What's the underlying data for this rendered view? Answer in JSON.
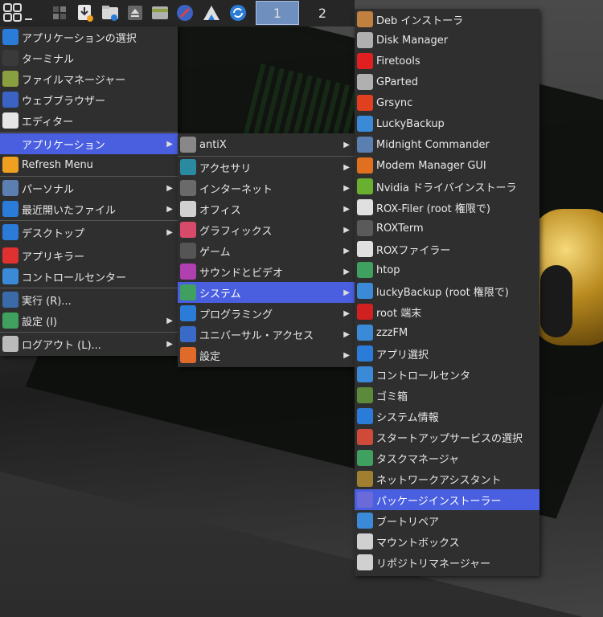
{
  "taskbar": {
    "workspaces": [
      "1",
      "2"
    ],
    "active_workspace": "1"
  },
  "main_menu": {
    "items": [
      {
        "label": "アプリケーションの選択",
        "icon": "search-icon",
        "color": "#2b7bd8"
      },
      {
        "label": "ターミナル",
        "icon": "terminal-icon",
        "color": "#3a3a3a"
      },
      {
        "label": "ファイルマネージャー",
        "icon": "file-manager-icon",
        "color": "#8aa040"
      },
      {
        "label": "ウェブブラウザー",
        "icon": "browser-icon",
        "color": "#3b63c4"
      },
      {
        "label": "エディター",
        "icon": "editor-icon",
        "color": "#e6e6e6"
      },
      {
        "label": "アプリケーション",
        "icon": "apps-grid-icon",
        "color": "#4a5fe0"
      },
      {
        "label": "Refresh Menu",
        "icon": "refresh-icon",
        "color": "#f0a020"
      },
      {
        "label": "パーソナル",
        "icon": "user-icon",
        "color": "#5a7fb0"
      },
      {
        "label": "最近開いたファイル",
        "icon": "recent-icon",
        "color": "#2b7bd8"
      },
      {
        "label": "デスクトップ",
        "icon": "desktop-icon",
        "color": "#2b7bd8"
      },
      {
        "label": "アプリキラー",
        "icon": "kill-icon",
        "color": "#e03030"
      },
      {
        "label": "コントロールセンター",
        "icon": "control-center-icon",
        "color": "#3a8ad8"
      },
      {
        "label": "実行 (R)...",
        "icon": "run-icon",
        "color": "#3a6aa8"
      },
      {
        "label": "設定 (I)",
        "icon": "settings-icon",
        "color": "#40a060"
      },
      {
        "label": "ログアウト (L)...",
        "icon": "power-icon",
        "color": "#bbbbbb"
      }
    ]
  },
  "apps_menu": {
    "items": [
      {
        "label": "antiX",
        "icon": "antix-icon",
        "color": "#888888"
      },
      {
        "label": "アクセサリ",
        "icon": "accessories-icon",
        "color": "#2a8aa0"
      },
      {
        "label": "インターネット",
        "icon": "internet-icon",
        "color": "#6a6a6a"
      },
      {
        "label": "オフィス",
        "icon": "office-icon",
        "color": "#d0d0d0"
      },
      {
        "label": "グラフィックス",
        "icon": "graphics-icon",
        "color": "#d84a6a"
      },
      {
        "label": "ゲーム",
        "icon": "game-icon",
        "color": "#555555"
      },
      {
        "label": "サウンドとビデオ",
        "icon": "multimedia-icon",
        "color": "#b040b0"
      },
      {
        "label": "システム",
        "icon": "system-icon",
        "color": "#40a060"
      },
      {
        "label": "プログラミング",
        "icon": "programming-icon",
        "color": "#2b7bd8"
      },
      {
        "label": "ユニバーサル・アクセス",
        "icon": "accessibility-icon",
        "color": "#3a6ac8"
      },
      {
        "label": "設定",
        "icon": "settings-icon",
        "color": "#e06a2a"
      }
    ]
  },
  "system_menu": {
    "items": [
      {
        "label": "Deb インストーラ",
        "icon": "deb-installer-icon",
        "color": "#c08040"
      },
      {
        "label": "Disk Manager",
        "icon": "disk-manager-icon",
        "color": "#b0b0b0"
      },
      {
        "label": "Firetools",
        "icon": "firetools-icon",
        "color": "#e02020"
      },
      {
        "label": "GParted",
        "icon": "gparted-icon",
        "color": "#b0b0b0"
      },
      {
        "label": "Grsync",
        "icon": "grsync-icon",
        "color": "#e04020"
      },
      {
        "label": "LuckyBackup",
        "icon": "luckybackup-icon",
        "color": "#3a8ad8"
      },
      {
        "label": "Midnight Commander",
        "icon": "midnight-commander-icon",
        "color": "#5a7fb0"
      },
      {
        "label": "Modem Manager GUI",
        "icon": "modem-icon",
        "color": "#e07020"
      },
      {
        "label": "Nvidia ドライバインストーラ",
        "icon": "nvidia-icon",
        "color": "#6ab030"
      },
      {
        "label": "ROX-Filer (root 権限で)",
        "icon": "rox-filer-icon",
        "color": "#e0e0e0"
      },
      {
        "label": "ROXTerm",
        "icon": "roxterm-icon",
        "color": "#5a5a5a"
      },
      {
        "label": "ROXファイラー",
        "icon": "rox-filer-icon",
        "color": "#e0e0e0"
      },
      {
        "label": "htop",
        "icon": "htop-icon",
        "color": "#40a060"
      },
      {
        "label": "luckyBackup (root 権限で)",
        "icon": "luckybackup-icon",
        "color": "#3a8ad8"
      },
      {
        "label": "root 端末",
        "icon": "root-terminal-icon",
        "color": "#d02020"
      },
      {
        "label": "zzzFM",
        "icon": "zzzfm-icon",
        "color": "#3a8ad8"
      },
      {
        "label": "アプリ選択",
        "icon": "search-icon",
        "color": "#2b7bd8"
      },
      {
        "label": "コントロールセンタ",
        "icon": "control-center-icon",
        "color": "#3a8ad8"
      },
      {
        "label": "ゴミ箱",
        "icon": "trash-icon",
        "color": "#5a8a3a"
      },
      {
        "label": "システム情報",
        "icon": "info-icon",
        "color": "#2b7bd8"
      },
      {
        "label": "スタートアップサービスの選択",
        "icon": "startup-icon",
        "color": "#d04a3a"
      },
      {
        "label": "タスクマネージャ",
        "icon": "task-manager-icon",
        "color": "#40a060"
      },
      {
        "label": "ネットワークアシスタント",
        "icon": "network-assistant-icon",
        "color": "#a08030"
      },
      {
        "label": "パッケージインストーラー",
        "icon": "package-installer-icon",
        "color": "#6a6ad8"
      },
      {
        "label": "ブートリペア",
        "icon": "boot-repair-icon",
        "color": "#3a8ad8"
      },
      {
        "label": "マウントボックス",
        "icon": "mountbox-icon",
        "color": "#d0d0d0"
      },
      {
        "label": "リポジトリマネージャー",
        "icon": "repo-manager-icon",
        "color": "#d0d0d0"
      }
    ]
  }
}
